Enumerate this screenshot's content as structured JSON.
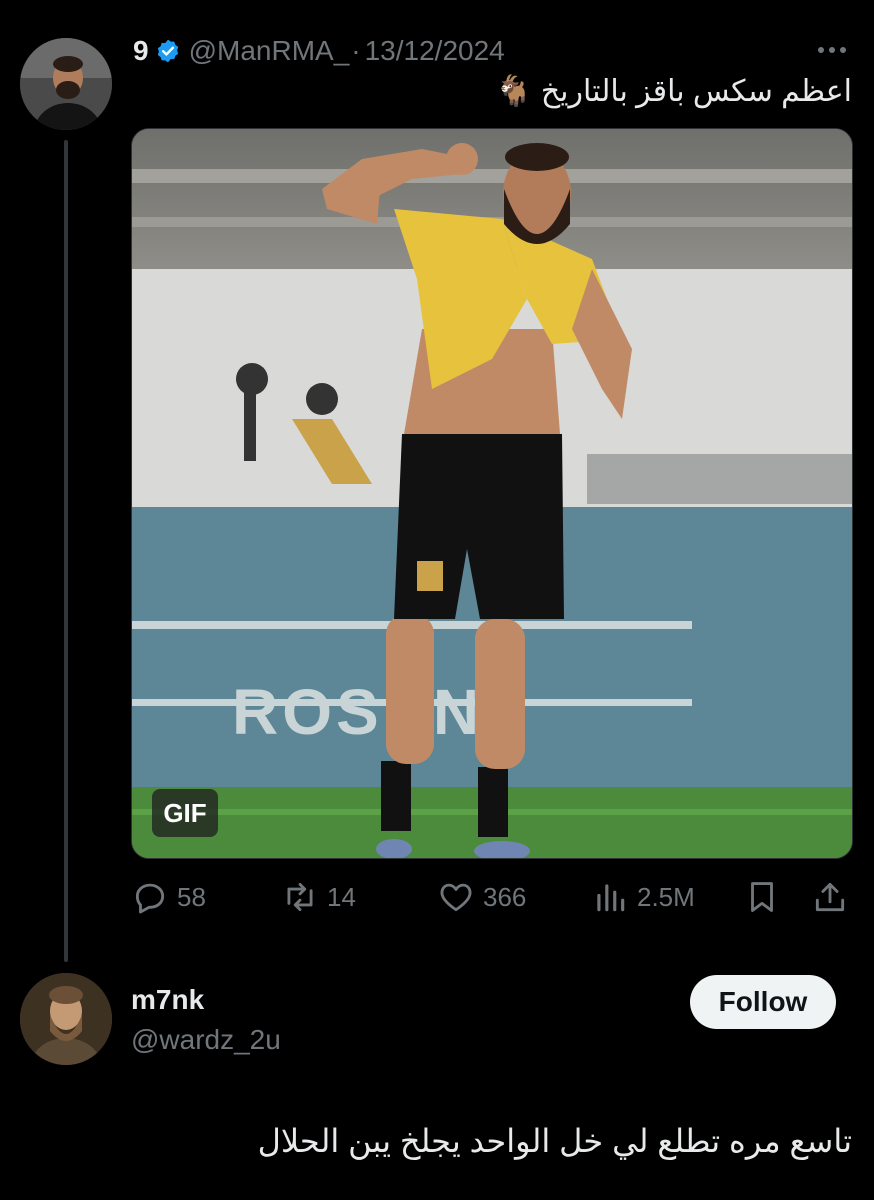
{
  "tweet": {
    "display_name": "9",
    "verified": true,
    "handle": "@ManRMA_",
    "separator": "·",
    "date": "13/12/2024",
    "text": "اعظم سكس باقز بالتاريخ 🐐",
    "media": {
      "type": "gif",
      "badge": "GIF",
      "content": "footballer in yellow jersey and black shorts lifting shirt and flexing arm on pitch"
    },
    "stats": {
      "replies": "58",
      "retweets": "14",
      "likes": "366",
      "views": "2.5M"
    },
    "icons": [
      "reply-icon",
      "retweet-icon",
      "like-icon",
      "views-icon",
      "bookmark-icon",
      "share-icon",
      "more-icon",
      "verified-icon"
    ],
    "colors": {
      "verified": "#1d9bf0",
      "muted": "#71767b",
      "text": "#e7e9ea",
      "background": "#000000"
    }
  },
  "suggested_user": {
    "name": "m7nk",
    "handle": "@wardz_2u",
    "follow_label": "Follow"
  },
  "reply": {
    "text": "تاسع مره تطلع لي خل الواحد يجلخ يبن الحلال"
  }
}
